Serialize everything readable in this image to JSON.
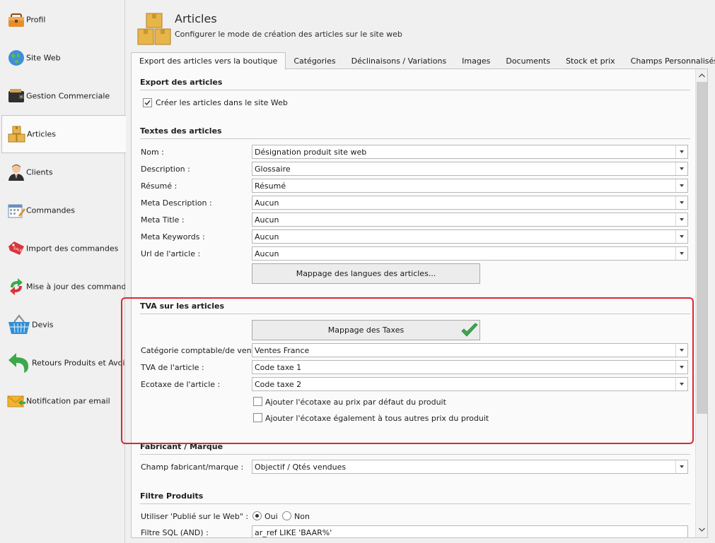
{
  "sidebar": {
    "items": [
      {
        "label": "Profil",
        "icon": "briefcase-icon"
      },
      {
        "label": "Site Web",
        "icon": "globe-icon"
      },
      {
        "label": "Gestion Commerciale",
        "icon": "wallet-icon"
      },
      {
        "label": "Articles",
        "icon": "boxes-icon"
      },
      {
        "label": "Clients",
        "icon": "user-icon"
      },
      {
        "label": "Commandes",
        "icon": "calendar-icon"
      },
      {
        "label": "Import des commandes",
        "icon": "sale-tag-icon"
      },
      {
        "label": "Mise à jour des commandes",
        "icon": "refresh-arrows-icon"
      },
      {
        "label": "Devis",
        "icon": "basket-icon"
      },
      {
        "label": "Retours Produits et Avoirs",
        "icon": "return-arrow-icon"
      },
      {
        "label": "Notification par email",
        "icon": "envelope-icon"
      }
    ]
  },
  "header": {
    "title": "Articles",
    "subtitle": "Configurer le mode de création des articles sur le site web",
    "icon": "boxes-icon"
  },
  "tabs": [
    {
      "label": "Export des articles vers la boutique"
    },
    {
      "label": "Catégories"
    },
    {
      "label": "Déclinaisons / Variations"
    },
    {
      "label": "Images"
    },
    {
      "label": "Documents"
    },
    {
      "label": "Stock et prix"
    },
    {
      "label": "Champs Personnalisés"
    }
  ],
  "export": {
    "title": "Export des articles",
    "create_label": "Créer les articles dans le site Web",
    "create_checked": true
  },
  "texts": {
    "title": "Textes des articles",
    "rows": [
      {
        "label": "Nom :",
        "value": "Désignation produit site web"
      },
      {
        "label": "Description :",
        "value": "Glossaire"
      },
      {
        "label": "Résumé :",
        "value": "Résumé"
      },
      {
        "label": "Meta Description :",
        "value": "Aucun"
      },
      {
        "label": "Meta Title :",
        "value": "Aucun"
      },
      {
        "label": "Meta Keywords :",
        "value": "Aucun"
      },
      {
        "label": "Url de l'article :",
        "value": "Aucun"
      }
    ],
    "mapping_button": "Mappage des langues des articles..."
  },
  "tva": {
    "title": "TVA sur les articles",
    "mapping_button": "Mappage des Taxes",
    "rows": [
      {
        "label": "Catégorie comptable/de vente :",
        "value": "Ventes France"
      },
      {
        "label": "TVA de l'article :",
        "value": "Code taxe 1"
      },
      {
        "label": "Ecotaxe de l'article :",
        "value": "Code taxe 2"
      }
    ],
    "check1": "Ajouter l'écotaxe au prix par défaut du produit",
    "check2": "Ajouter l'écotaxe également à tous autres prix du produit",
    "highlight_color": "#e0262e"
  },
  "fabricant": {
    "title": "Fabricant / Marque",
    "label": "Champ fabricant/marque :",
    "value": "Objectif / Qtés vendues"
  },
  "filtre": {
    "title": "Filtre Produits",
    "published_label": "Utiliser 'Publié sur le Web\" :",
    "oui": "Oui",
    "non": "Non",
    "selected": "Oui",
    "sql_label": "Filtre SQL (AND) :",
    "sql_value": "ar_ref LIKE 'BAAR%'"
  }
}
